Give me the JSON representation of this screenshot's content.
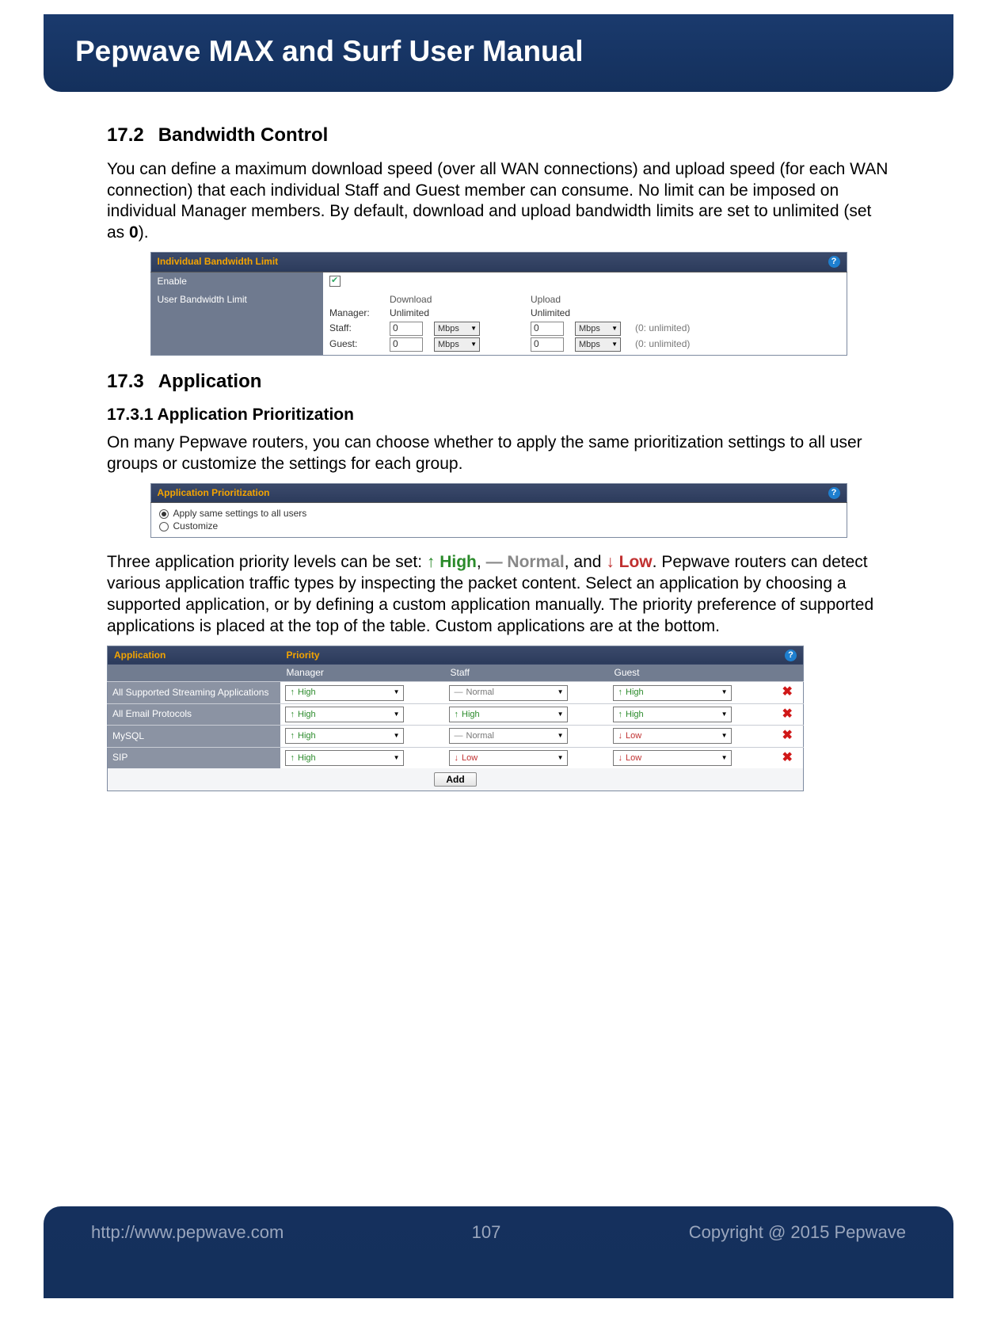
{
  "header": {
    "title": "Pepwave MAX and Surf User Manual"
  },
  "section_172": {
    "num": "17.2",
    "title": "Bandwidth Control",
    "para_a": "You can define a maximum download speed (over all WAN connections) and upload speed (for each WAN connection) that each individual Staff and Guest member can consume. No limit can be imposed on individual Manager members. By default, download and upload bandwidth limits are set to unlimited (set as ",
    "para_b": "0",
    "para_c": ")."
  },
  "bwui": {
    "title": "Individual Bandwidth Limit",
    "enable_label": "Enable",
    "enable_checked": true,
    "user_label": "User Bandwidth Limit",
    "cols": {
      "download": "Download",
      "upload": "Upload"
    },
    "rows": {
      "manager": {
        "label": "Manager:",
        "download": "Unlimited",
        "upload": "Unlimited"
      },
      "staff": {
        "label": "Staff:",
        "dl_val": "0",
        "dl_unit": "Mbps",
        "ul_val": "0",
        "ul_unit": "Mbps",
        "hint": "(0: unlimited)"
      },
      "guest": {
        "label": "Guest:",
        "dl_val": "0",
        "dl_unit": "Mbps",
        "ul_val": "0",
        "ul_unit": "Mbps",
        "hint": "(0: unlimited)"
      }
    }
  },
  "section_173": {
    "num": "17.3",
    "title": "Application",
    "sub_num_title": "17.3.1 Application Prioritization",
    "para1": "On many Pepwave routers, you can choose whether to apply the same prioritization settings to all user groups or customize the settings for each group.",
    "para2_a": "Three application priority levels can be set: ",
    "high_arrow": "↑",
    "high_text": "High",
    "sep1": ",",
    "normal_dash": "—",
    "normal_text": "Normal",
    "sep2": ", and ",
    "low_arrow": "↓",
    "low_text": "Low",
    "para2_b": ". Pepwave routers can detect various application traffic types by inspecting the packet content. Select an application by choosing a supported application, or by defining a custom application manually. The priority preference of supported applications is placed at the top of the table. Custom applications are at the bottom."
  },
  "prioui": {
    "title": "Application Prioritization",
    "opt_same": "Apply same settings to all users",
    "opt_custom": "Customize",
    "selected": "same"
  },
  "apptable": {
    "hdr_app": "Application",
    "hdr_prio": "Priority",
    "cols": {
      "manager": "Manager",
      "staff": "Staff",
      "guest": "Guest"
    },
    "rows": [
      {
        "label": "All Supported Streaming Applications",
        "manager": "High",
        "staff": "Normal",
        "guest": "High"
      },
      {
        "label": "All Email Protocols",
        "manager": "High",
        "staff": "High",
        "guest": "High"
      },
      {
        "label": "MySQL",
        "manager": "High",
        "staff": "Normal",
        "guest": "Low"
      },
      {
        "label": "SIP",
        "manager": "High",
        "staff": "Low",
        "guest": "Low"
      }
    ],
    "add_label": "Add"
  },
  "footer": {
    "url": "http://www.pepwave.com",
    "page": "107",
    "copyright": "Copyright @ 2015 Pepwave"
  },
  "glyphs": {
    "help": "?",
    "delete": "✖"
  }
}
